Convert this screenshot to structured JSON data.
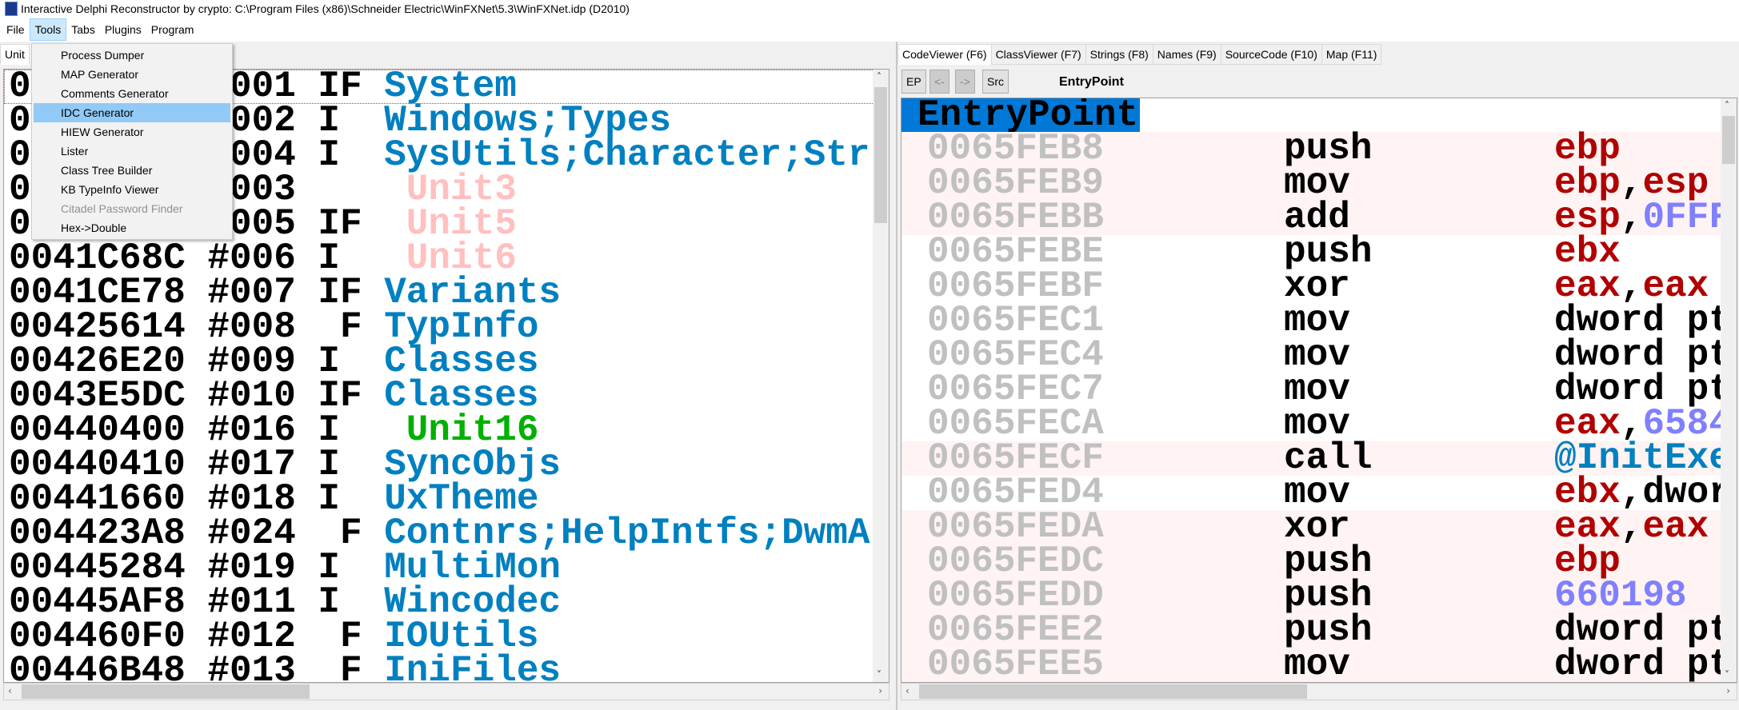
{
  "window": {
    "title": "Interactive Delphi Reconstructor by crypto: C:\\Program Files (x86)\\Schneider Electric\\WinFXNet\\5.3\\WinFXNet.idp (D2010)"
  },
  "menubar": [
    "File",
    "Tools",
    "Tabs",
    "Plugins",
    "Program"
  ],
  "tools_menu": [
    {
      "label": "Process Dumper"
    },
    {
      "label": "MAP Generator"
    },
    {
      "label": "Comments Generator"
    },
    {
      "label": "IDC Generator",
      "highlighted": true
    },
    {
      "label": "HIEW Generator"
    },
    {
      "label": "Lister"
    },
    {
      "label": "Class Tree Builder"
    },
    {
      "label": "KB TypeInfo Viewer"
    },
    {
      "label": "Citadel Password Finder",
      "disabled": true
    },
    {
      "label": "Hex->Double"
    }
  ],
  "left_panel": {
    "tab": "Unit",
    "rows": [
      {
        "addr": "0",
        "num": "#001",
        "flag": "IF",
        "name": "System",
        "kind": "normal"
      },
      {
        "addr": "0",
        "num": "#002",
        "flag": "I",
        "name": "Windows;Types",
        "kind": "normal"
      },
      {
        "addr": "0",
        "num": "#004",
        "flag": "I",
        "name": "SysUtils;Character;Str",
        "kind": "normal"
      },
      {
        "addr": "0",
        "num": "#003",
        "flag": "",
        "name": " Unit3",
        "kind": "unknown"
      },
      {
        "addr": "0",
        "num": "#005",
        "flag": "IF",
        "name": " Unit5",
        "kind": "unknown"
      },
      {
        "addr": "0041C68C",
        "num": "#006",
        "flag": "I",
        "name": " Unit6",
        "kind": "unknown"
      },
      {
        "addr": "0041CE78",
        "num": "#007",
        "flag": "IF",
        "name": "Variants",
        "kind": "normal"
      },
      {
        "addr": "00425614",
        "num": "#008",
        "flag": " F",
        "name": "TypInfo",
        "kind": "normal"
      },
      {
        "addr": "00426E20",
        "num": "#009",
        "flag": "I",
        "name": "Classes",
        "kind": "normal"
      },
      {
        "addr": "0043E5DC",
        "num": "#010",
        "flag": "IF",
        "name": "Classes",
        "kind": "normal"
      },
      {
        "addr": "00440400",
        "num": "#016",
        "flag": "I",
        "name": " Unit16",
        "kind": "user"
      },
      {
        "addr": "00440410",
        "num": "#017",
        "flag": "I",
        "name": "SyncObjs",
        "kind": "normal"
      },
      {
        "addr": "00441660",
        "num": "#018",
        "flag": "I",
        "name": "UxTheme",
        "kind": "normal"
      },
      {
        "addr": "004423A8",
        "num": "#024",
        "flag": " F",
        "name": "Contnrs;HelpIntfs;DwmA",
        "kind": "normal"
      },
      {
        "addr": "00445284",
        "num": "#019",
        "flag": "I",
        "name": "MultiMon",
        "kind": "normal"
      },
      {
        "addr": "00445AF8",
        "num": "#011",
        "flag": "I",
        "name": "Wincodec",
        "kind": "normal"
      },
      {
        "addr": "004460F0",
        "num": "#012",
        "flag": " F",
        "name": "IOUtils",
        "kind": "normal"
      },
      {
        "addr": "00446B48",
        "num": "#013",
        "flag": " F",
        "name": "IniFiles",
        "kind": "normal"
      }
    ]
  },
  "right_panel": {
    "tabs": [
      "CodeViewer (F6)",
      "ClassViewer (F7)",
      "Strings (F8)",
      "Names (F9)",
      "SourceCode (F10)",
      "Map (F11)"
    ],
    "toolbar": {
      "ep": "EP",
      "back": "<-",
      "forward": "->",
      "src": "Src",
      "current": "EntryPoint"
    },
    "header": "EntryPoint",
    "rows": [
      {
        "addr": "0065FEB8",
        "op": "push",
        "args": [
          [
            "reg",
            "ebp"
          ]
        ],
        "pink": true
      },
      {
        "addr": "0065FEB9",
        "op": "mov",
        "args": [
          [
            "reg",
            "ebp"
          ],
          [
            "txt",
            ","
          ],
          [
            "reg",
            "esp"
          ]
        ],
        "pink": true
      },
      {
        "addr": "0065FEBB",
        "op": "add",
        "args": [
          [
            "reg",
            "esp"
          ],
          [
            "txt",
            ","
          ],
          [
            "num",
            "0FFF"
          ]
        ],
        "pink": true
      },
      {
        "addr": "0065FEBE",
        "op": "push",
        "args": [
          [
            "reg",
            "ebx"
          ]
        ],
        "pink": false
      },
      {
        "addr": "0065FEBF",
        "op": "xor",
        "args": [
          [
            "reg",
            "eax"
          ],
          [
            "txt",
            ","
          ],
          [
            "reg",
            "eax"
          ]
        ],
        "pink": false
      },
      {
        "addr": "0065FEC1",
        "op": "mov",
        "args": [
          [
            "txt",
            "dword pt"
          ]
        ],
        "pink": false
      },
      {
        "addr": "0065FEC4",
        "op": "mov",
        "args": [
          [
            "txt",
            "dword pt"
          ]
        ],
        "pink": false
      },
      {
        "addr": "0065FEC7",
        "op": "mov",
        "args": [
          [
            "txt",
            "dword pt"
          ]
        ],
        "pink": false
      },
      {
        "addr": "0065FECA",
        "op": "mov",
        "args": [
          [
            "reg",
            "eax"
          ],
          [
            "txt",
            ","
          ],
          [
            "num",
            "6584"
          ]
        ],
        "pink": false
      },
      {
        "addr": "0065FECF",
        "op": "call",
        "args": [
          [
            "sym",
            "@InitExe"
          ]
        ],
        "pink": true
      },
      {
        "addr": "0065FED4",
        "op": "mov",
        "args": [
          [
            "reg",
            "ebx"
          ],
          [
            "txt",
            ",dwor"
          ]
        ],
        "pink": false
      },
      {
        "addr": "0065FEDA",
        "op": "xor",
        "args": [
          [
            "reg",
            "eax"
          ],
          [
            "txt",
            ","
          ],
          [
            "reg",
            "eax"
          ]
        ],
        "pink": true
      },
      {
        "addr": "0065FEDC",
        "op": "push",
        "args": [
          [
            "reg",
            "ebp"
          ]
        ],
        "pink": true
      },
      {
        "addr": "0065FEDD",
        "op": "push",
        "args": [
          [
            "num",
            "660198"
          ]
        ],
        "pink": true
      },
      {
        "addr": "0065FEE2",
        "op": "push",
        "args": [
          [
            "txt",
            "dword pt"
          ]
        ],
        "pink": true
      },
      {
        "addr": "0065FEE5",
        "op": "mov",
        "args": [
          [
            "txt",
            "dword pt"
          ]
        ],
        "pink": true
      }
    ]
  },
  "colors": {
    "unit_name": "#0080c0",
    "unknown_unit": "#ffc0c0",
    "user_unit": "#00b000",
    "register": "#b00000",
    "number": "#8080ff",
    "symbol": "#0080c0",
    "address": "#c0c0c0",
    "pink_row": "#fff3f3",
    "header_bg": "#0078d7",
    "menu_highlight": "#91c9f7"
  }
}
